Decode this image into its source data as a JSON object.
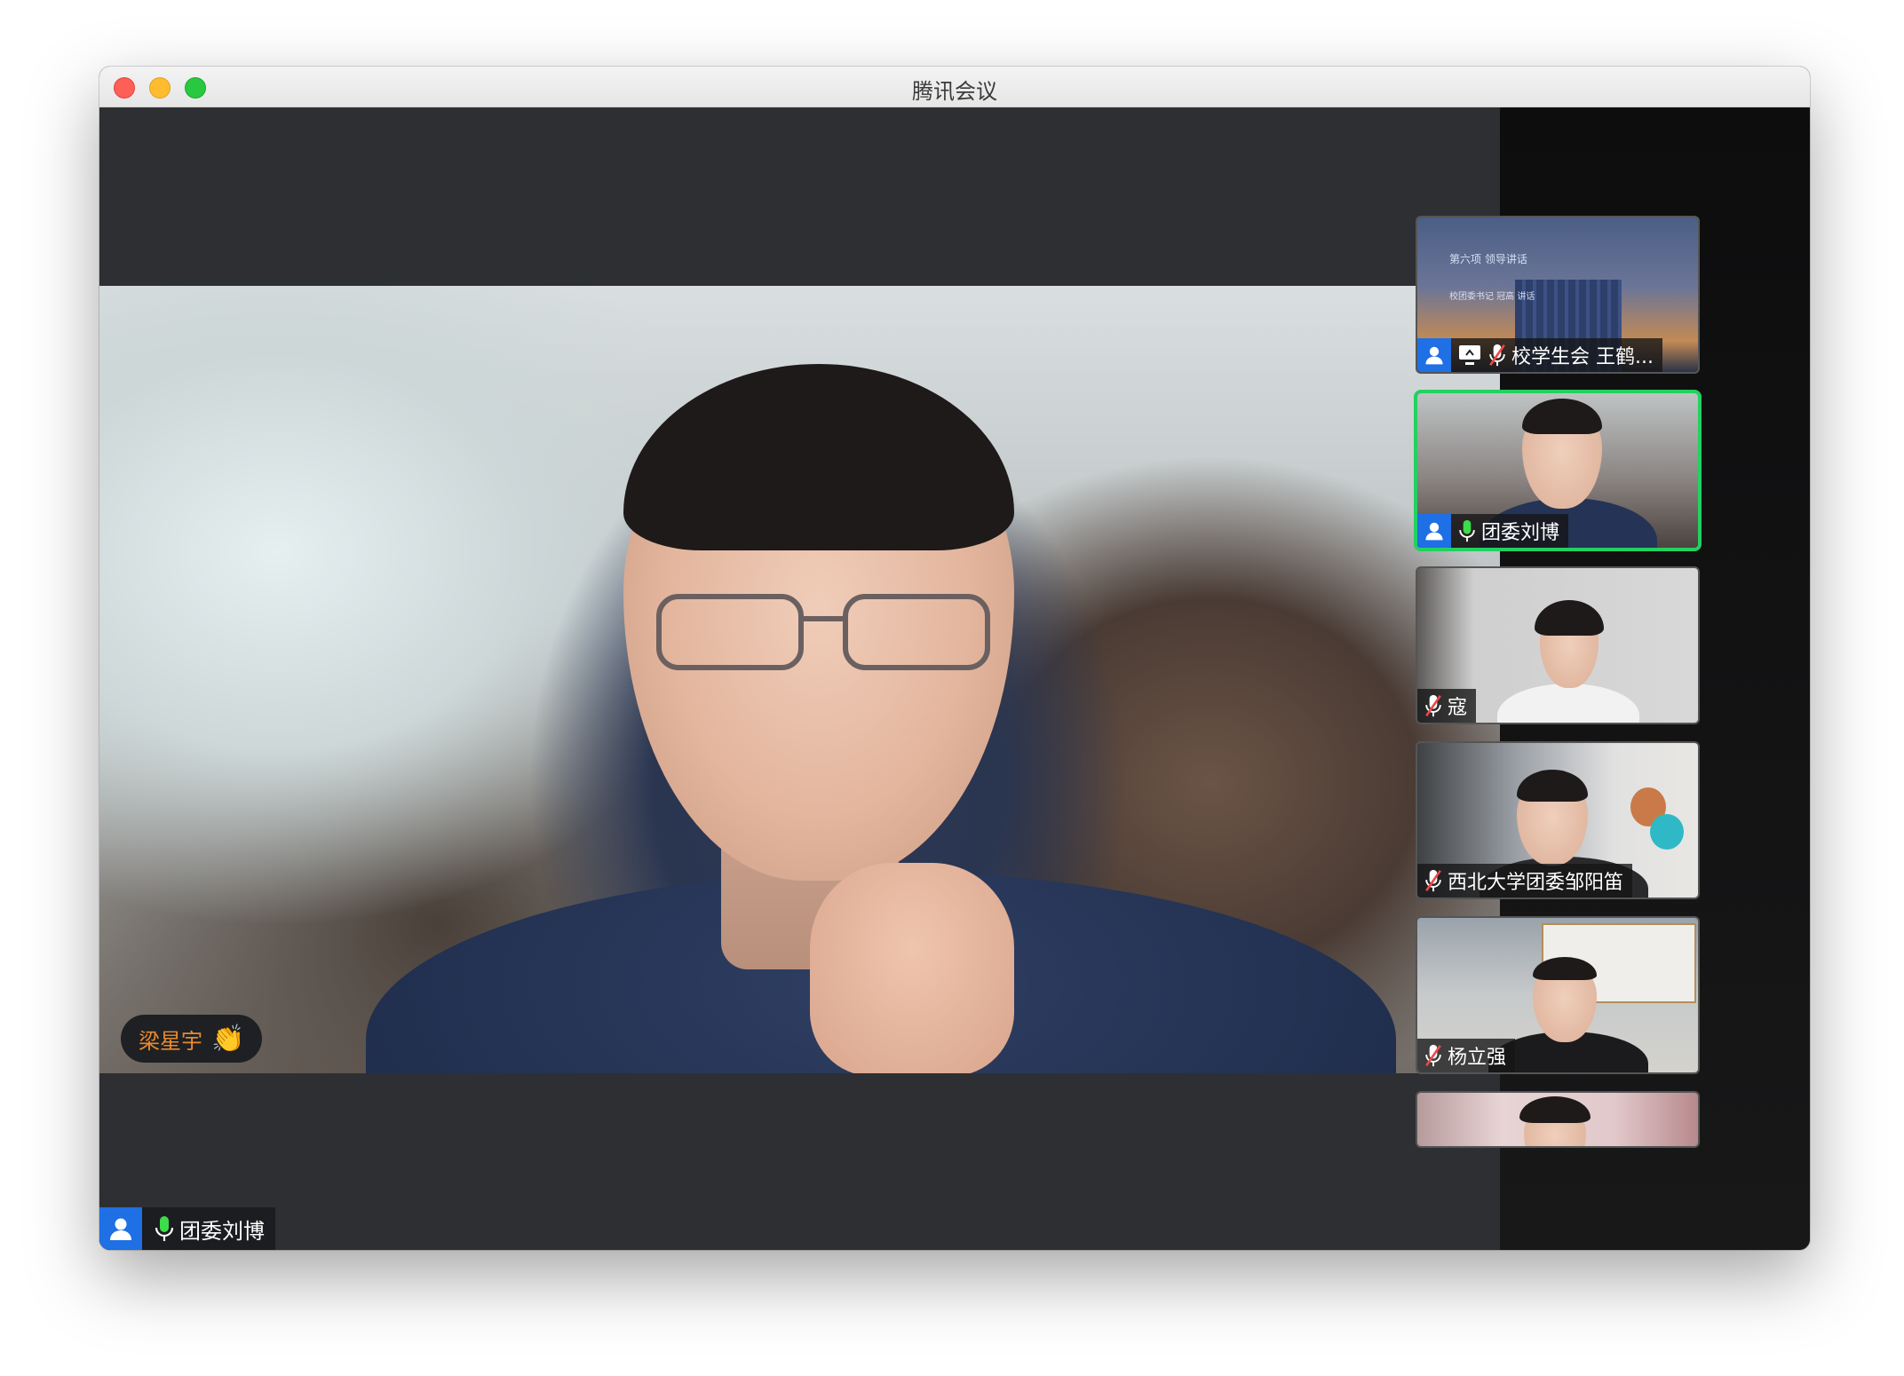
{
  "window": {
    "title": "腾讯会议"
  },
  "main_video": {
    "speaker_name": "团委刘博",
    "reaction_name": "梁星宇",
    "reaction_emoji": "👏"
  },
  "participants": [
    {
      "name": "校学生会 王鹤...",
      "mic": "muted",
      "sharing": true,
      "active": false,
      "slide_text": [
        "第六项   领导讲话",
        "校团委书记 冠高 讲话"
      ]
    },
    {
      "name": "团委刘博",
      "mic": "on",
      "sharing": false,
      "active": true
    },
    {
      "name": "寇",
      "mic": "muted",
      "sharing": false,
      "active": false
    },
    {
      "name": "西北大学团委邹阳笛",
      "mic": "muted",
      "sharing": false,
      "active": false
    },
    {
      "name": "杨立强",
      "mic": "muted",
      "sharing": false,
      "active": false
    }
  ],
  "colors": {
    "accent_green": "#23d160",
    "avatar_blue": "#1f6fe5",
    "reaction_orange": "#e98a2f",
    "mic_green": "#3ddc4a"
  },
  "icons": [
    "user-avatar-icon",
    "mic-on-icon",
    "mic-muted-icon",
    "screen-share-icon",
    "chevron-right-icon",
    "clap-emoji-icon"
  ]
}
